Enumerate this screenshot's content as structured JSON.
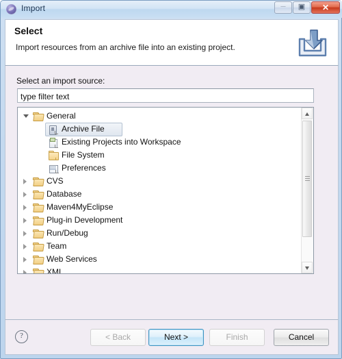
{
  "window": {
    "title": "Import",
    "icon": "eclipse-import-icon",
    "controls": {
      "minimize": "–",
      "maximize": "▣",
      "close": "✕"
    }
  },
  "header": {
    "title": "Select",
    "description": "Import resources from an archive file into an existing project.",
    "icon": "import-arrow-tray-icon"
  },
  "source": {
    "label": "Select an import source:",
    "filter_placeholder": "type filter text",
    "filter_value": ""
  },
  "tree": {
    "rows": [
      {
        "label": "General",
        "indent": 0,
        "twisty": "expanded",
        "icon": "folder-open-icon",
        "selected": false
      },
      {
        "label": "Archive File",
        "indent": 1,
        "twisty": "none",
        "icon": "archive-file-icon",
        "selected": true
      },
      {
        "label": "Existing Projects into Workspace",
        "indent": 1,
        "twisty": "none",
        "icon": "project-import-icon",
        "selected": false
      },
      {
        "label": "File System",
        "indent": 1,
        "twisty": "none",
        "icon": "folder-closed-icon",
        "selected": false
      },
      {
        "label": "Preferences",
        "indent": 1,
        "twisty": "none",
        "icon": "preferences-icon",
        "selected": false
      },
      {
        "label": "CVS",
        "indent": 0,
        "twisty": "collapsed",
        "icon": "folder-open-icon",
        "selected": false
      },
      {
        "label": "Database",
        "indent": 0,
        "twisty": "collapsed",
        "icon": "folder-open-icon",
        "selected": false
      },
      {
        "label": "Maven4MyEclipse",
        "indent": 0,
        "twisty": "collapsed",
        "icon": "folder-open-icon",
        "selected": false
      },
      {
        "label": "Plug-in Development",
        "indent": 0,
        "twisty": "collapsed",
        "icon": "folder-open-icon",
        "selected": false
      },
      {
        "label": "Run/Debug",
        "indent": 0,
        "twisty": "collapsed",
        "icon": "folder-open-icon",
        "selected": false
      },
      {
        "label": "Team",
        "indent": 0,
        "twisty": "collapsed",
        "icon": "folder-open-icon",
        "selected": false
      },
      {
        "label": "Web Services",
        "indent": 0,
        "twisty": "collapsed",
        "icon": "folder-open-icon",
        "selected": false
      },
      {
        "label": "XML",
        "indent": 0,
        "twisty": "collapsed",
        "icon": "folder-open-icon",
        "selected": false
      }
    ],
    "scrollbar": {
      "up_arrow": "▲",
      "down_arrow": "▼"
    }
  },
  "footer": {
    "help_label": "?",
    "buttons": [
      {
        "name": "back",
        "label": "< Back",
        "state": "disabled"
      },
      {
        "name": "next",
        "label": "Next >",
        "state": "default"
      },
      {
        "name": "finish",
        "label": "Finish",
        "state": "disabled"
      },
      {
        "name": "cancel",
        "label": "Cancel",
        "state": "enabled"
      }
    ]
  },
  "colors": {
    "titlebar": "#c9dff3",
    "dialog_bg": "#f1ecf3",
    "header_bg": "#ffffff",
    "close_button": "#c73a1d",
    "default_button_border": "#3e93c1",
    "folder": "#f4d38d"
  }
}
